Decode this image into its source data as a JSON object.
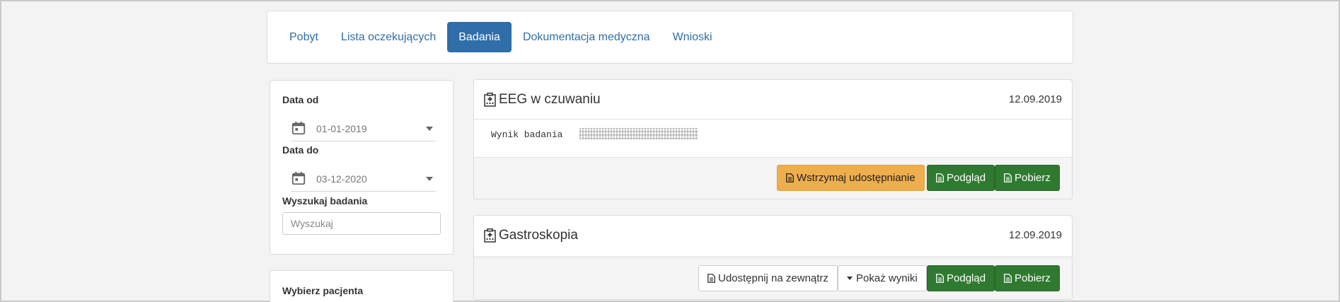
{
  "nav": {
    "tabs": [
      {
        "label": "Pobyt"
      },
      {
        "label": "Lista oczekujących"
      },
      {
        "label": "Badania"
      },
      {
        "label": "Dokumentacja medyczna"
      },
      {
        "label": "Wnioski"
      }
    ],
    "active_tab": "Badania"
  },
  "filters": {
    "date_from_label": "Data od",
    "date_from_value": "01-01-2019",
    "date_to_label": "Data do",
    "date_to_value": "03-12-2020",
    "search_label": "Wyszukaj badania",
    "search_placeholder": "Wyszukaj",
    "search_value": ""
  },
  "patient": {
    "label": "Wybierz pacjenta"
  },
  "exams": [
    {
      "title": "EEG w czuwaniu",
      "date": "12.09.2019",
      "result_text": "Wynik badania",
      "buttons": {
        "stop_share": "Wstrzymaj udostępnianie",
        "preview": "Podgląd",
        "download": "Pobierz"
      }
    },
    {
      "title": "Gastroskopia",
      "date": "12.09.2019",
      "buttons": {
        "share_external": "Udostępnij na zewnątrz",
        "show_results": "Pokaż wyniki",
        "preview": "Podgląd",
        "download": "Pobierz"
      }
    }
  ],
  "colors": {
    "primary": "#2f6ea9",
    "warning": "#efae4e",
    "success": "#2f7a30"
  },
  "icons": {
    "nav_active": "tab-highlight",
    "calendar": "calendar-icon",
    "exam": "hospital-icon",
    "file": "file-icon",
    "caret": "caret-down-icon"
  }
}
